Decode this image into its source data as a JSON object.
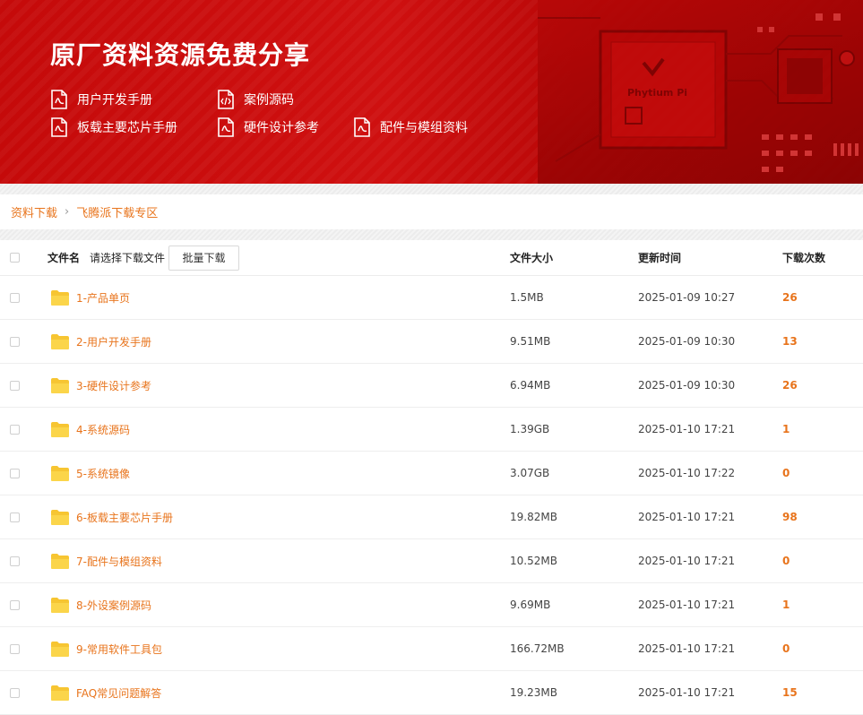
{
  "banner": {
    "title": "原厂资料资源免费分享",
    "links": [
      {
        "label": "用户开发手册",
        "icon": "pdf-document-icon"
      },
      {
        "label": "案例源码",
        "icon": "code-document-icon"
      },
      {
        "label": "板载主要芯片手册",
        "icon": "pdf-document-icon"
      },
      {
        "label": "硬件设计参考",
        "icon": "pdf-document-icon"
      },
      {
        "label": "配件与模组资料",
        "icon": "pdf-document-icon"
      }
    ],
    "chip_brand": "Phytium Pi"
  },
  "breadcrumb": {
    "root": "资料下载",
    "current": "飞腾派下载专区"
  },
  "table": {
    "headers": {
      "name": "文件名",
      "hint": "请选择下载文件",
      "batch_button": "批量下载",
      "size": "文件大小",
      "time": "更新时间",
      "count": "下载次数"
    },
    "rows": [
      {
        "name": "1-产品单页",
        "size": "1.5MB",
        "time": "2025-01-09 10:27",
        "count": "26"
      },
      {
        "name": "2-用户开发手册",
        "size": "9.51MB",
        "time": "2025-01-09 10:30",
        "count": "13"
      },
      {
        "name": "3-硬件设计参考",
        "size": "6.94MB",
        "time": "2025-01-09 10:30",
        "count": "26"
      },
      {
        "name": "4-系统源码",
        "size": "1.39GB",
        "time": "2025-01-10 17:21",
        "count": "1"
      },
      {
        "name": "5-系统镜像",
        "size": "3.07GB",
        "time": "2025-01-10 17:22",
        "count": "0"
      },
      {
        "name": "6-板载主要芯片手册",
        "size": "19.82MB",
        "time": "2025-01-10 17:21",
        "count": "98"
      },
      {
        "name": "7-配件与模组资料",
        "size": "10.52MB",
        "time": "2025-01-10 17:21",
        "count": "0"
      },
      {
        "name": "8-外设案例源码",
        "size": "9.69MB",
        "time": "2025-01-10 17:21",
        "count": "1"
      },
      {
        "name": "9-常用软件工具包",
        "size": "166.72MB",
        "time": "2025-01-10 17:21",
        "count": "0"
      },
      {
        "name": "FAQ常见问题解答",
        "size": "19.23MB",
        "time": "2025-01-10 17:21",
        "count": "15"
      }
    ]
  },
  "colors": {
    "banner_red": "#c50a0a",
    "accent_orange": "#e8741c"
  }
}
